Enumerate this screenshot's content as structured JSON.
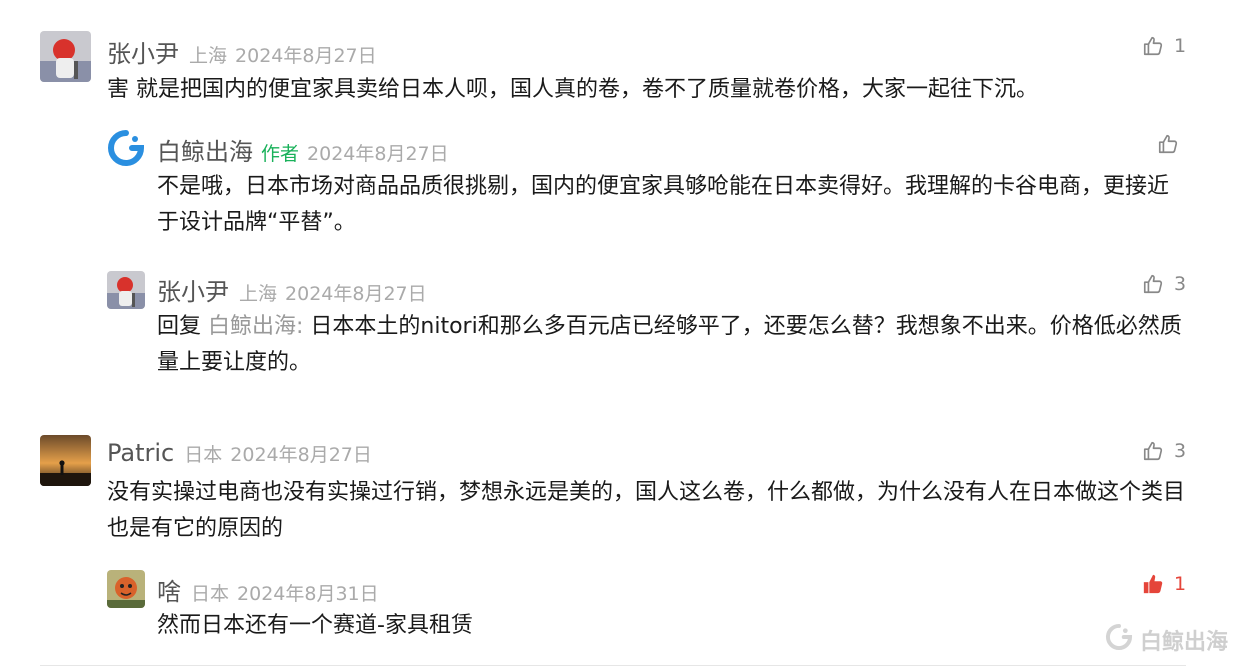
{
  "comments": [
    {
      "name": "张小尹",
      "location": "上海",
      "date": "2024年8月27日",
      "likes": "1",
      "text": "害 就是把国内的便宜家具卖给日本人呗，国人真的卷，卷不了质量就卷价格，大家一起往下沉。",
      "replies": [
        {
          "name": "白鲸出海",
          "author_tag": "作者",
          "date": "2024年8月27日",
          "likes": "",
          "text": "不是哦，日本市场对商品品质很挑剔，国内的便宜家具够呛能在日本卖得好。我理解的卡谷电商，更接近于设计品牌“平替”。"
        },
        {
          "name": "张小尹",
          "location": "上海",
          "date": "2024年8月27日",
          "likes": "3",
          "reply_prefix": "回复 ",
          "reply_target": "白鲸出海:",
          "text": " 日本本土的nitori和那么多百元店已经够平了，还要怎么替？我想象不出来。价格低必然质量上要让度的。"
        }
      ]
    },
    {
      "name": "Patric",
      "location": "日本",
      "date": "2024年8月27日",
      "likes": "3",
      "text": "没有实操过电商也没有实操过行销，梦想永远是美的，国人这么卷，什么都做，为什么没有人在日本做这个类目也是有它的原因的",
      "replies": [
        {
          "name": "啥",
          "location": "日本",
          "date": "2024年8月31日",
          "likes": "1",
          "text": "然而日本还有一个赛道-家具租赁"
        }
      ]
    }
  ],
  "watermark": "白鲸出海",
  "colors": {
    "author_tag": "#19b15a",
    "like_active": "#e5453a",
    "meta_gray": "#aaaaaa"
  },
  "icons": [
    "thumbs-up-icon",
    "thumbs-up-filled-icon",
    "whale-logo-icon"
  ]
}
